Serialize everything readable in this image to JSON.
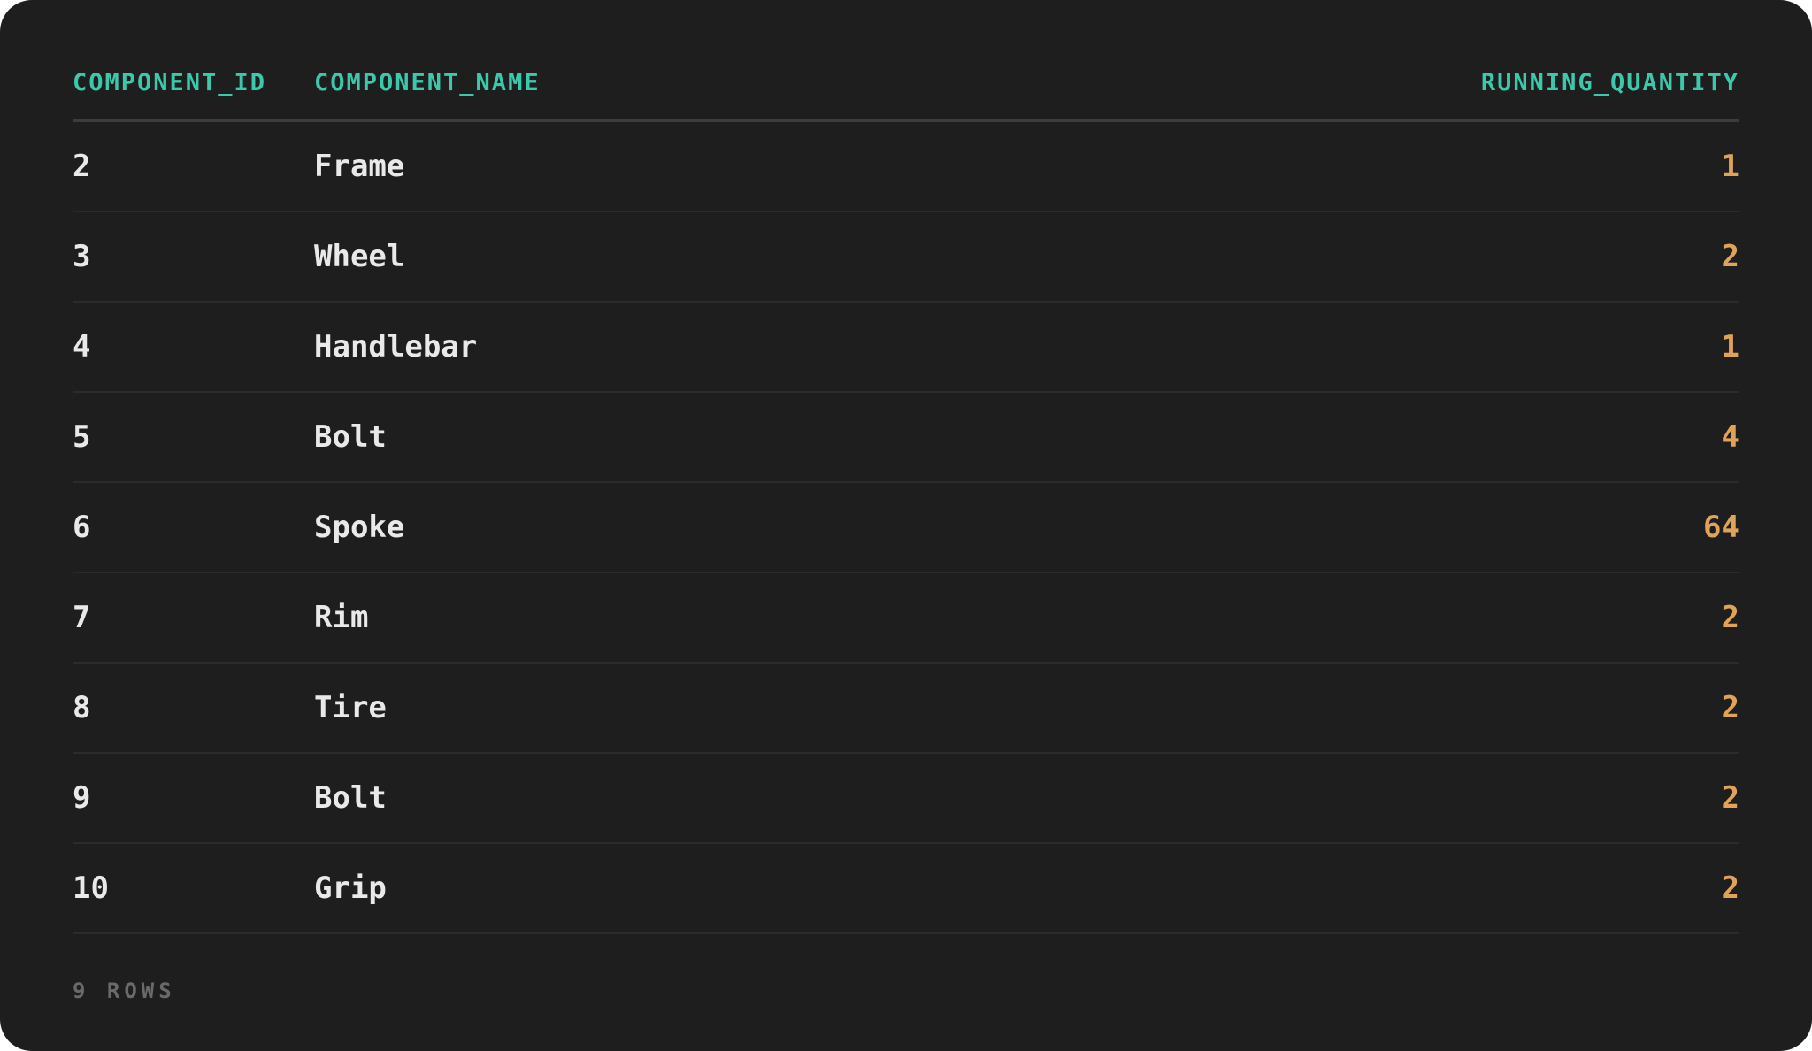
{
  "colors": {
    "background": "#1e1e1e",
    "header_text": "#3cc8aa",
    "cell_text": "#e9e9e9",
    "quantity_text": "#e0a35a",
    "footer_text": "#6a6a6a"
  },
  "table": {
    "columns": [
      "COMPONENT_ID",
      "COMPONENT_NAME",
      "RUNNING_QUANTITY"
    ],
    "rows": [
      {
        "component_id": "2",
        "component_name": "Frame",
        "running_quantity": "1"
      },
      {
        "component_id": "3",
        "component_name": "Wheel",
        "running_quantity": "2"
      },
      {
        "component_id": "4",
        "component_name": "Handlebar",
        "running_quantity": "1"
      },
      {
        "component_id": "5",
        "component_name": "Bolt",
        "running_quantity": "4"
      },
      {
        "component_id": "6",
        "component_name": "Spoke",
        "running_quantity": "64"
      },
      {
        "component_id": "7",
        "component_name": "Rim",
        "running_quantity": "2"
      },
      {
        "component_id": "8",
        "component_name": "Tire",
        "running_quantity": "2"
      },
      {
        "component_id": "9",
        "component_name": "Bolt",
        "running_quantity": "2"
      },
      {
        "component_id": "10",
        "component_name": "Grip",
        "running_quantity": "2"
      }
    ]
  },
  "footer": {
    "row_count": "9 ROWS"
  }
}
